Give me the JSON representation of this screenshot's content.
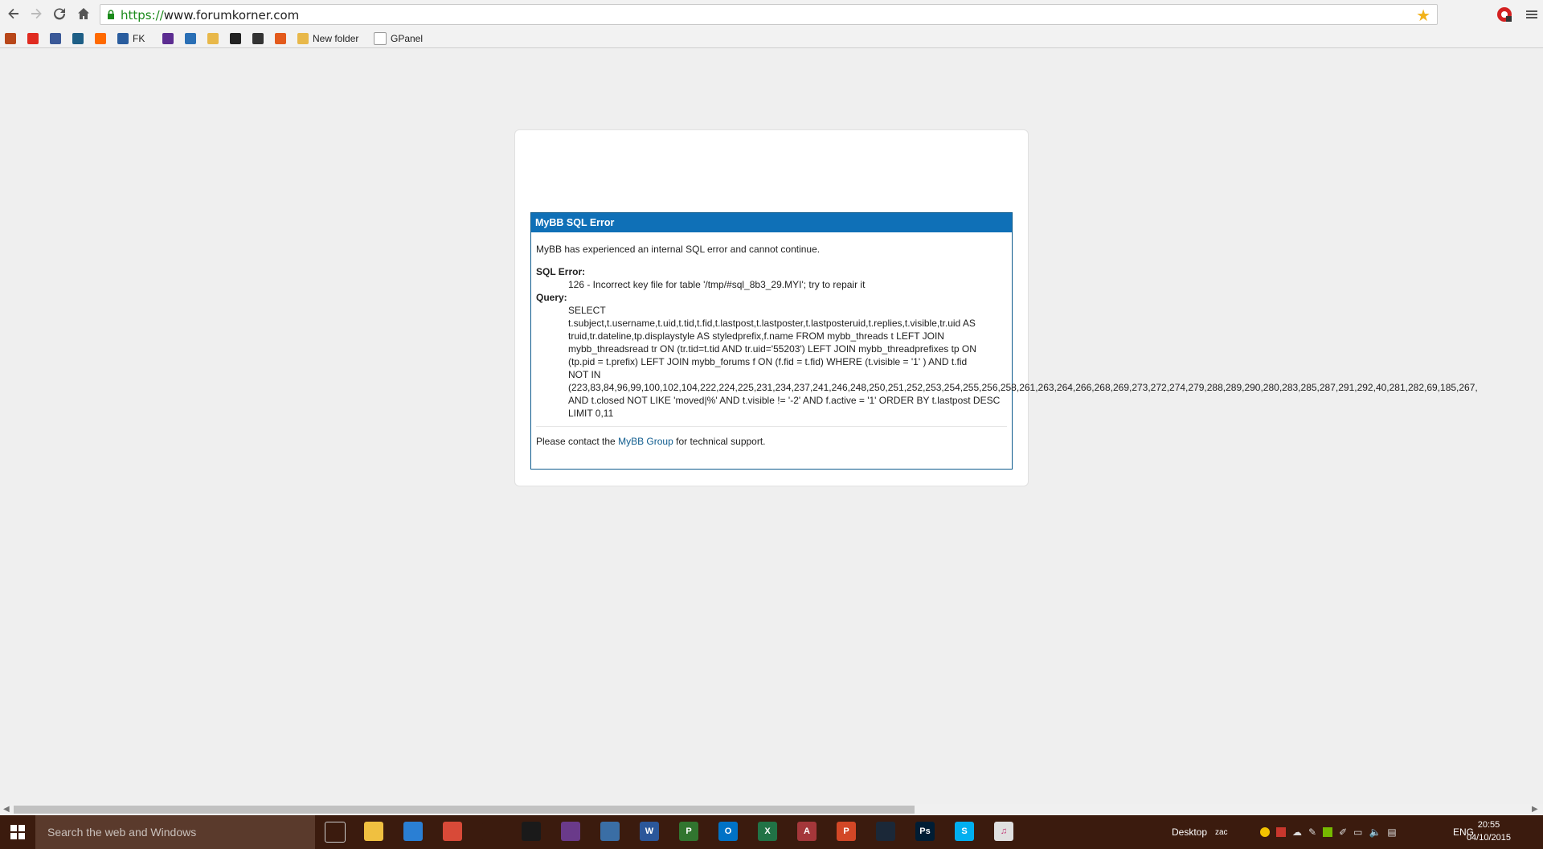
{
  "browser": {
    "url_scheme": "https://",
    "url_host": "www.forumkorner.com",
    "bookmarks": [
      {
        "label": "",
        "icon": "grid-icon",
        "color": "#b8471a"
      },
      {
        "label": "",
        "icon": "youtube-icon",
        "color": "#e02b20"
      },
      {
        "label": "",
        "icon": "facebook-icon",
        "color": "#3b5998"
      },
      {
        "label": "",
        "icon": "camera-icon",
        "color": "#1e5f86"
      },
      {
        "label": "",
        "icon": "soundcloud-icon",
        "color": "#ff6a00"
      },
      {
        "label": "FK",
        "icon": "fk-icon",
        "color": "#2a5d9e"
      },
      {
        "label": "",
        "icon": "yahoo-mail-icon",
        "color": "#5c2d91"
      },
      {
        "label": "",
        "icon": "a-icon",
        "color": "#2a6fb5"
      },
      {
        "label": "",
        "icon": "folder-icon",
        "color": "#e8b84a"
      },
      {
        "label": "",
        "icon": "e-circle-icon",
        "color": "#222222"
      },
      {
        "label": "",
        "icon": "movie-icon",
        "color": "#333333"
      },
      {
        "label": "",
        "icon": "g-icon",
        "color": "#e35a1c"
      },
      {
        "label": "New folder",
        "icon": "folder-icon",
        "color": "#e8b84a"
      },
      {
        "label": "GPanel",
        "icon": "page-icon",
        "color": "#ffffff"
      }
    ]
  },
  "error": {
    "title": "MyBB SQL Error",
    "intro": "MyBB has experienced an internal SQL error and cannot continue.",
    "sql_error_label": "SQL Error:",
    "sql_error_text": "126 - Incorrect key file for table '/tmp/#sql_8b3_29.MYI'; try to repair it",
    "query_label": "Query:",
    "query_lines": [
      "SELECT",
      "t.subject,t.username,t.uid,t.tid,t.fid,t.lastpost,t.lastposter,t.lastposteruid,t.replies,t.visible,tr.uid AS",
      "truid,tr.dateline,tp.displaystyle AS styledprefix,f.name FROM mybb_threads t LEFT JOIN",
      "mybb_threadsread tr ON (tr.tid=t.tid AND tr.uid='55203') LEFT JOIN mybb_threadprefixes tp ON",
      "(tp.pid = t.prefix) LEFT JOIN mybb_forums f ON (f.fid = t.fid) WHERE (t.visible = '1' ) AND t.fid",
      "NOT IN",
      "(223,83,84,96,99,100,102,104,222,224,225,231,234,237,241,246,248,250,251,252,253,254,255,256,258,261,263,264,266,268,269,273,272,274,279,288,289,290,280,283,285,287,291,292,40,281,282,69,185,267,",
      "AND t.closed NOT LIKE 'moved|%' AND t.visible != '-2' AND f.active = '1' ORDER BY t.lastpost DESC",
      "LIMIT 0,11"
    ],
    "footer_before": "Please contact the ",
    "footer_link": "MyBB Group",
    "footer_after": " for technical support."
  },
  "taskbar": {
    "search_placeholder": "Search the web and Windows",
    "apps": [
      {
        "icon": "task-view-icon",
        "color": "#3b1b0e",
        "label": ""
      },
      {
        "icon": "file-explorer-icon",
        "color": "#f0c040",
        "label": ""
      },
      {
        "icon": "store-pinned-icon",
        "color": "#2a7fd4",
        "label": ""
      },
      {
        "icon": "chrome-icon",
        "color": "#d84a38",
        "label": ""
      },
      {
        "icon": "store-icon",
        "color": "#3b1b0e",
        "label": ""
      },
      {
        "icon": "terminal-icon",
        "color": "#1a1a1a",
        "label": ""
      },
      {
        "icon": "winrar-icon",
        "color": "#6a3a8a",
        "label": ""
      },
      {
        "icon": "notepad-icon",
        "color": "#3a6ea5",
        "label": ""
      },
      {
        "icon": "word-icon",
        "color": "#2b579a",
        "label": "W"
      },
      {
        "icon": "project-icon",
        "color": "#31752f",
        "label": "P"
      },
      {
        "icon": "outlook-icon",
        "color": "#0072c6",
        "label": "O"
      },
      {
        "icon": "excel-icon",
        "color": "#217346",
        "label": "X"
      },
      {
        "icon": "access-icon",
        "color": "#a4373a",
        "label": "A"
      },
      {
        "icon": "powerpoint-icon",
        "color": "#d24726",
        "label": "P"
      },
      {
        "icon": "steam-icon",
        "color": "#1b2838",
        "label": ""
      },
      {
        "icon": "photoshop-icon",
        "color": "#001d34",
        "label": "Ps"
      },
      {
        "icon": "skype-icon",
        "color": "#00aff0",
        "label": "S"
      },
      {
        "icon": "itunes-icon",
        "color": "#e0e0e0",
        "label": "♫"
      }
    ],
    "desktop_label": "Desktop",
    "user_label": "zac",
    "language": "ENG",
    "time": "20:55",
    "date": "04/10/2015"
  }
}
